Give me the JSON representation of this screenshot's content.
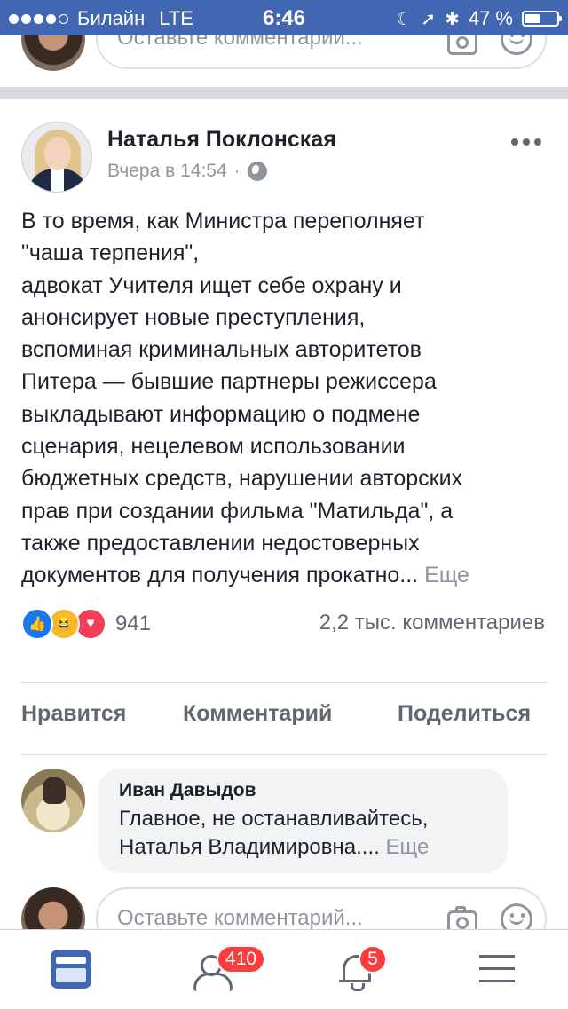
{
  "status_bar": {
    "carrier": "Билайн",
    "network": "LTE",
    "time": "6:46",
    "battery_percent": "47 %",
    "battery_level": 0.47
  },
  "top_comment_input": {
    "placeholder": "Оставьте комментарий..."
  },
  "post": {
    "author": "Наталья Поклонская",
    "timestamp": "Вчера в 14:54",
    "privacy_icon": "globe-icon",
    "text_lines": [
      "В то время, как Министра переполняет",
      "\"чаша терпения\",",
      "адвокат Учителя ищет себе охрану и",
      "анонсирует новые преступления,",
      "вспоминая криминальных авторитетов",
      "Питера — бывшие партнеры режиссера",
      "выкладывают информацию о подмене",
      "сценария, нецелевом использовании",
      "бюджетных средств, нарушении авторских",
      "прав при создании фильма \"Матильда\", а",
      "также предоставлении недостоверных",
      "документов для получения прокатно..."
    ],
    "see_more": "Еще",
    "reactions": [
      "like",
      "haha",
      "love"
    ],
    "reaction_count": "941",
    "comment_count": "2,2 тыс. комментариев"
  },
  "actions": {
    "like": "Нравится",
    "comment": "Комментарий",
    "share": "Поделиться"
  },
  "comment": {
    "author": "Иван Давыдов",
    "lines": [
      "Главное, не останавливайтесь,",
      "Наталья Владимировна...."
    ],
    "see_more": "Еще"
  },
  "bottom_comment_input": {
    "placeholder": "Оставьте комментарий..."
  },
  "tab_bar": {
    "friends_badge": "410",
    "notifications_badge": "5"
  },
  "colors": {
    "brand": "#4267b2",
    "badge": "#fa3e3e",
    "like": "#1877f2",
    "haha": "#f7b928",
    "love": "#f33e58"
  }
}
